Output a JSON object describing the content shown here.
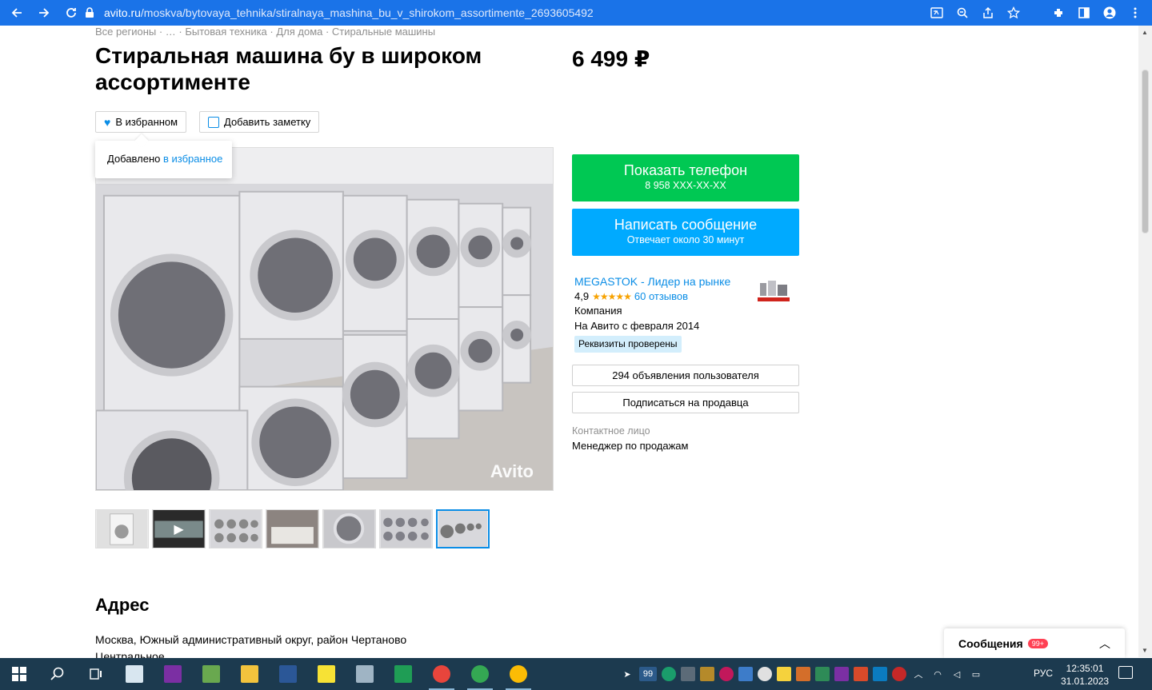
{
  "browser": {
    "url_host": "avito.ru",
    "url_path": "/moskva/bytovaya_tehnika/stiralnaya_mashina_bu_v_shirokom_assortimente_2693605492"
  },
  "breadcrumbs": "Все регионы · … · Бытовая техника · Для дома · Стиральные машины",
  "listing": {
    "title": "Стиральная машина бу в широком ассортименте",
    "price": "6 499 ₽"
  },
  "actions": {
    "favorite_label": "В избранном",
    "note_label": "Добавить заметку",
    "tooltip_prefix": "Добавлено ",
    "tooltip_link": "в избранное"
  },
  "photo": {
    "watermark": "Avito"
  },
  "contact": {
    "show_phone_label": "Показать телефон",
    "phone_masked": "8 958 XXX-XX-XX",
    "write_label": "Написать сообщение",
    "write_sub": "Отвечает около 30 минут"
  },
  "seller": {
    "name": "MEGASTOK - Лидер на рынке",
    "rating": "4,9",
    "stars": "★★★★★",
    "reviews": "60 отзывов",
    "type": "Компания",
    "since": "На Авито с февраля 2014",
    "badge": "Реквизиты проверены",
    "ads_label": "294 объявления пользователя",
    "subscribe_label": "Подписаться на продавца",
    "contact_label": "Контактное лицо",
    "contact_value": "Менеджер по продажам"
  },
  "address": {
    "title": "Адрес",
    "text": "Москва, Южный административный округ, район Чертаново Центральное"
  },
  "messages": {
    "label": "Сообщения",
    "count": "99+"
  },
  "taskbar": {
    "tray_badge": "99",
    "lang": "РУС",
    "time": "12:35:01",
    "date": "31.01.2023"
  },
  "colors": {
    "chrome": "#1a73e8",
    "green_button": "#00c853",
    "blue_button": "#00aaff",
    "link": "#0a8de6",
    "taskbar": "#1c3a4f"
  }
}
